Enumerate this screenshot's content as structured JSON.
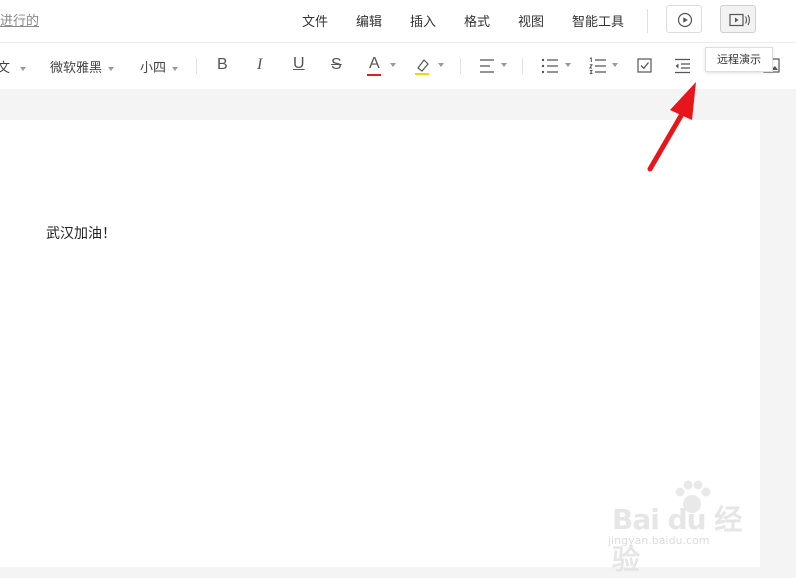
{
  "topbar": {
    "history_link": "进行的",
    "menu": [
      "文件",
      "编辑",
      "插入",
      "格式",
      "视图",
      "智能工具"
    ]
  },
  "tooltip": "远程演示",
  "toolbar": {
    "font_style": "文",
    "font_family": "微软雅黑",
    "font_size": "小四",
    "bold": "B",
    "italic": "I",
    "underline": "U",
    "strike": "S",
    "font_color": "A",
    "font_color_value": "#e02020",
    "highlight_color_value": "#f5d800"
  },
  "document": {
    "text": "武汉加油！"
  },
  "watermark": {
    "logo": "Bai du 经验",
    "url": "jingyan.baidu.com"
  },
  "icons": [
    "play-icon",
    "remote-present-icon",
    "align-icon",
    "bullet-list-icon",
    "numbered-list-icon",
    "checkbox-icon",
    "outdent-icon",
    "image-icon",
    "highlight-icon"
  ],
  "colors": {
    "arrow": "#e8161b",
    "accent_red": "#e02020"
  }
}
